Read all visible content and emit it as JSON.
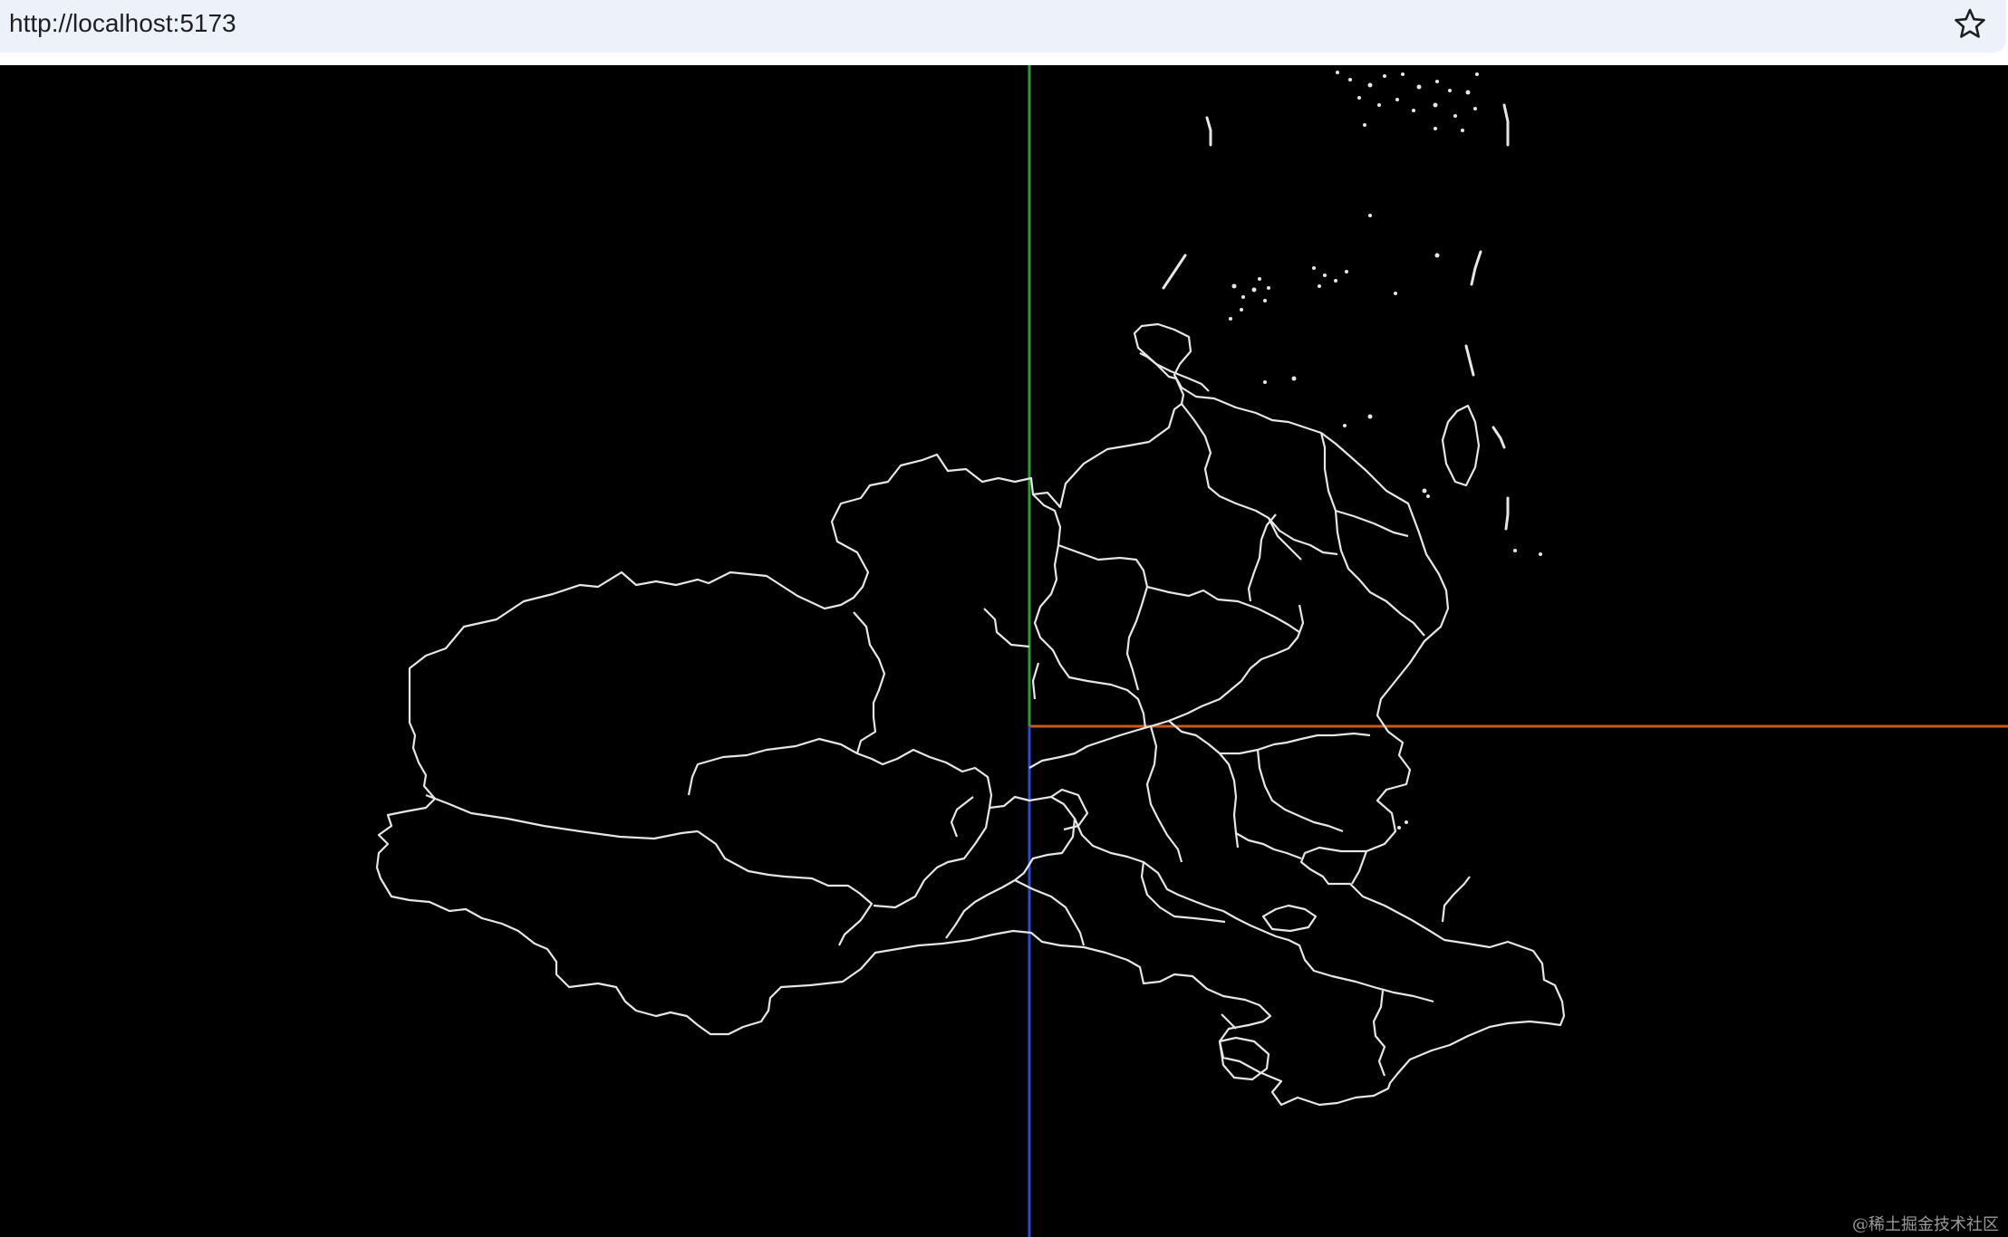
{
  "browser": {
    "url": "http://localhost:5173",
    "bookmark_icon": "star-outline-icon"
  },
  "scene": {
    "background_color": "#000000",
    "outline_color": "#e6e6e6",
    "axes": {
      "x_color": "#c85a1e",
      "y_color": "#2e9e2e",
      "z_color": "#2a4bd6"
    }
  },
  "watermark": "@稀土掘金技术社区"
}
